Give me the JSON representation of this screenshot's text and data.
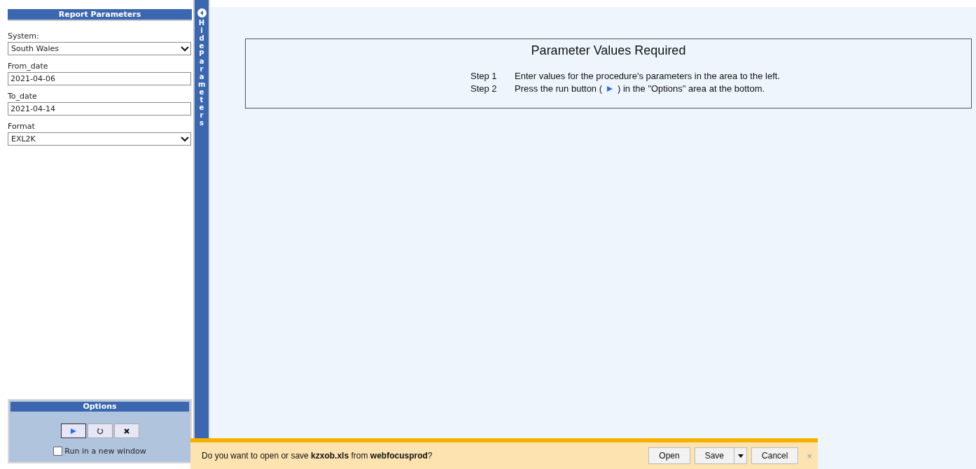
{
  "parameters_panel": {
    "title": "Report Parameters",
    "fields": [
      {
        "kind": "select",
        "label": "System:",
        "value": "South Wales"
      },
      {
        "kind": "text",
        "label": "From_date",
        "value": "2021-04-06"
      },
      {
        "kind": "text",
        "label": "To_date",
        "value": "2021-04-14"
      },
      {
        "kind": "select",
        "label": "Format",
        "value": "EXL2K"
      }
    ]
  },
  "options_panel": {
    "title": "Options",
    "run_new_window": {
      "label": "Run in a new window",
      "checked": false
    }
  },
  "hide_toggle": {
    "label": "Hide Parameters"
  },
  "instructions": {
    "title": "Parameter Values Required",
    "steps": [
      {
        "label": "Step 1",
        "text": "Enter values for the procedure's parameters in the area to the left."
      },
      {
        "label": "Step 2",
        "text": "Press the run button (",
        "text_after": ") in the \"Options\" area at the bottom."
      }
    ]
  },
  "download_bar": {
    "message": "Do you want to open or save **kzxob.xls** from **webfocusprod**?",
    "buttons": [
      "Open",
      "Save",
      "Cancel"
    ],
    "close": "×"
  }
}
